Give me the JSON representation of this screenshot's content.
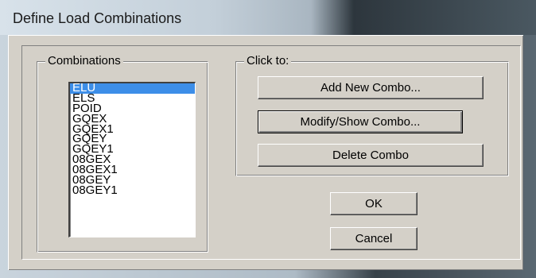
{
  "window": {
    "title": "Define Load Combinations"
  },
  "combinations_group": {
    "label": "Combinations",
    "items": [
      "ELU",
      "ELS",
      "POID",
      "GQEX",
      "GQEX1",
      "GQEY",
      "GQEY1",
      "08GEX",
      "08GEX1",
      "08GEY",
      "08GEY1"
    ],
    "selected": "ELU"
  },
  "click_to_group": {
    "label": "Click to:",
    "add_label": "Add New Combo...",
    "modify_label": "Modify/Show Combo...",
    "delete_label": "Delete Combo"
  },
  "dialog_buttons": {
    "ok_label": "OK",
    "cancel_label": "Cancel"
  },
  "colors": {
    "dialog_face": "#d4d0c8",
    "selection": "#3d8ee8"
  }
}
